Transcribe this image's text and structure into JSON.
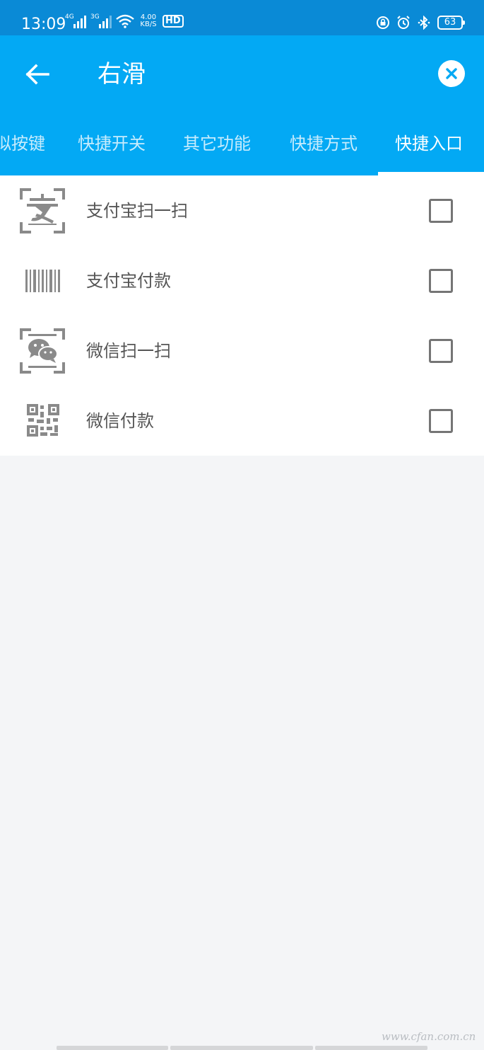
{
  "status_bar": {
    "time": "13:09",
    "net1": "4G",
    "net2": "3G",
    "speed_value": "4.00",
    "speed_unit": "KB/S",
    "hd": "HD",
    "battery": "63"
  },
  "header": {
    "title": "右滑"
  },
  "tabs": [
    {
      "label": "拟按键"
    },
    {
      "label": "快捷开关"
    },
    {
      "label": "其它功能"
    },
    {
      "label": "快捷方式"
    },
    {
      "label": "快捷入口"
    }
  ],
  "active_tab": "快捷入口",
  "items": [
    {
      "label": "支付宝扫一扫",
      "icon": "alipay-scan-icon",
      "checked": false
    },
    {
      "label": "支付宝付款",
      "icon": "barcode-icon",
      "checked": false
    },
    {
      "label": "微信扫一扫",
      "icon": "wechat-scan-icon",
      "checked": false
    },
    {
      "label": "微信付款",
      "icon": "qr-code-icon",
      "checked": false
    }
  ],
  "watermark": "www.cfan.com.cn",
  "colors": {
    "status_bar": "#0a8ad6",
    "app_bar": "#03a9f4",
    "background": "#f4f5f7",
    "icon_gray": "#8a8a8a"
  }
}
